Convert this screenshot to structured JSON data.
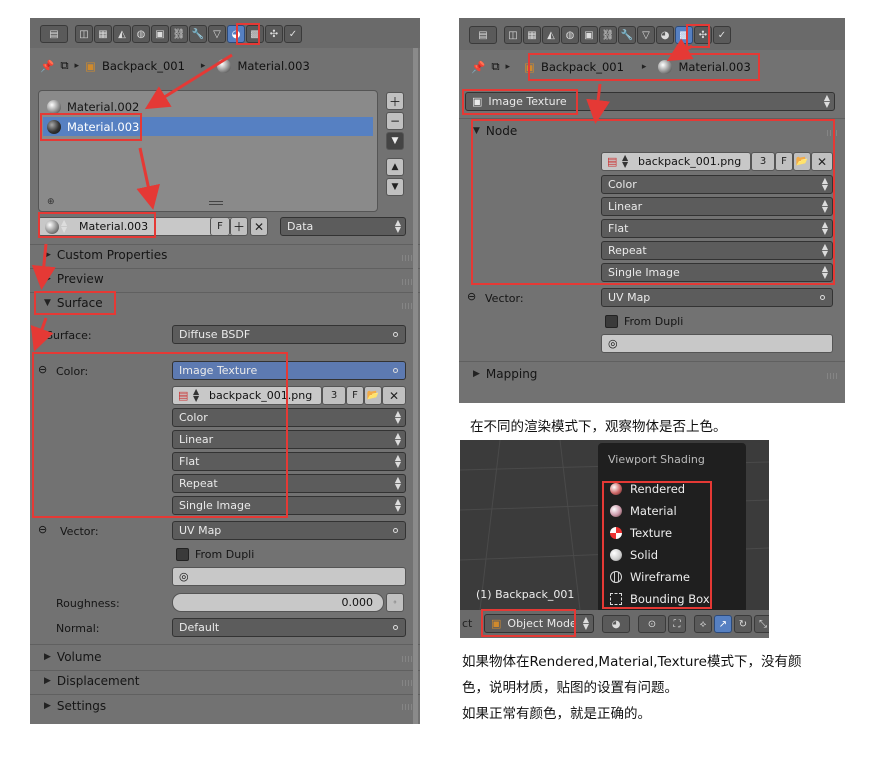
{
  "left": {
    "breadcrumb": {
      "object": "Backpack_001",
      "material": "Material.003"
    },
    "materials": [
      "Material.002",
      "Material.003"
    ],
    "slot": {
      "name": "Material.003",
      "fake_user": "F",
      "link": "Data"
    },
    "sections": {
      "custom_properties": "Custom Properties",
      "preview": "Preview",
      "surface": "Surface",
      "volume": "Volume",
      "displacement": "Displacement",
      "settings": "Settings"
    },
    "surface": {
      "label": "Surface:",
      "value": "Diffuse BSDF"
    },
    "color": {
      "label": "Color:",
      "node": "Image Texture",
      "image": "backpack_001.png",
      "users": "3",
      "fake": "F",
      "options": [
        "Color",
        "Linear",
        "Flat",
        "Repeat",
        "Single Image"
      ]
    },
    "vector": {
      "label": "Vector:",
      "value": "UV Map",
      "from_dupli": "From Dupli"
    },
    "roughness": {
      "label": "Roughness:",
      "value": "0.000"
    },
    "normal": {
      "label": "Normal:",
      "value": "Default"
    }
  },
  "right": {
    "breadcrumb": {
      "object": "Backpack_001",
      "material": "Material.003"
    },
    "node_type": "Image Texture",
    "node_section": "Node",
    "image": "backpack_001.png",
    "users": "3",
    "fake": "F",
    "options": [
      "Color",
      "Linear",
      "Flat",
      "Repeat",
      "Single Image"
    ],
    "vector": {
      "label": "Vector:",
      "value": "UV Map",
      "from_dupli": "From Dupli"
    },
    "mapping": "Mapping"
  },
  "caption1": "在不同的渲染模式下，观察物体是否上色。",
  "viewport": {
    "menu_title": "Viewport Shading",
    "items": [
      "Rendered",
      "Material",
      "Texture",
      "Solid",
      "Wireframe",
      "Bounding Box"
    ],
    "object_label": "(1) Backpack_001",
    "mode": "Object Mode",
    "left_cut": "ct"
  },
  "caption2": [
    "如果物体在Rendered,Material,Texture模式下，没有颜",
    "色，说明材质，贴图的设置有问题。",
    "如果正常有颜色，就是正确的。"
  ],
  "colors": {
    "highlight": "#e53935",
    "selection": "#5680c2",
    "panel": "#727272"
  }
}
